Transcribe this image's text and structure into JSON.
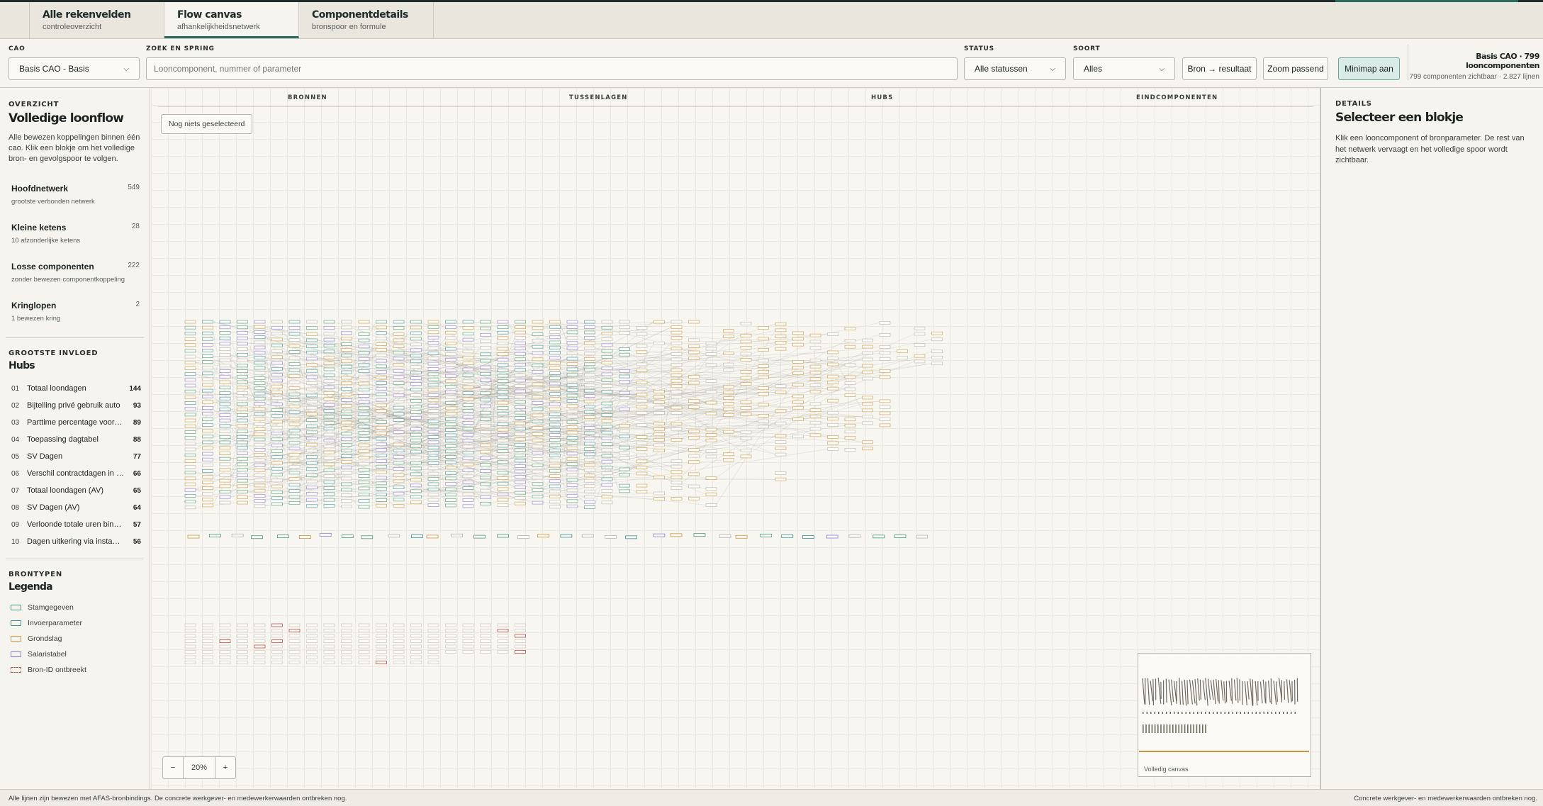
{
  "tabs": [
    {
      "title": "Alle rekenvelden",
      "sub": "controleoverzicht"
    },
    {
      "title": "Flow canvas",
      "sub": "afhankelijkheidsnetwerk"
    },
    {
      "title": "Componentdetails",
      "sub": "bronspoor en formule"
    }
  ],
  "filters": {
    "cao_label": "CAO",
    "cao_value": "Basis CAO - Basis",
    "search_label": "ZOEK EN SPRING",
    "search_placeholder": "Looncomponent, nummer of parameter",
    "status_label": "STATUS",
    "status_value": "Alle statussen",
    "soort_label": "SOORT",
    "soort_value": "Alles",
    "btn_bron": "Bron → resultaat",
    "btn_zoom": "Zoom passend",
    "btn_minimap": "Minimap aan"
  },
  "summary": {
    "title": "Basis CAO · 799 looncomponenten",
    "sub": "799 componenten zichtbaar · 2.827 lijnen"
  },
  "overview": {
    "eyebrow": "OVERZICHT",
    "title": "Volledige loonflow",
    "desc": "Alle bewezen koppelingen binnen één cao. Klik een blokje om het volledige bron- en gevolgspoor te volgen.",
    "networks": [
      {
        "name": "Hoofdnetwerk",
        "sub": "grootste verbonden netwerk",
        "count": "549"
      },
      {
        "name": "Kleine ketens",
        "sub": "10 afzonderlijke ketens",
        "count": "28"
      },
      {
        "name": "Losse componenten",
        "sub": "zonder bewezen componentkoppeling",
        "count": "222"
      },
      {
        "name": "Kringlopen",
        "sub": "1 bewezen kring",
        "count": "2"
      }
    ]
  },
  "hubs": {
    "eyebrow": "GROOTSTE INVLOED",
    "title": "Hubs",
    "items": [
      {
        "rank": "01",
        "name": "Totaal loondagen",
        "value": "144"
      },
      {
        "rank": "02",
        "name": "Bijtelling privé gebruik auto",
        "value": "93"
      },
      {
        "rank": "03",
        "name": "Parttime percentage voor to...",
        "value": "89"
      },
      {
        "rank": "04",
        "name": "Toepassing dagtabel",
        "value": "88"
      },
      {
        "rank": "05",
        "name": "SV Dagen",
        "value": "77"
      },
      {
        "rank": "06",
        "name": "Verschil contractdagen in p...",
        "value": "66"
      },
      {
        "rank": "07",
        "name": "Totaal loondagen (AV)",
        "value": "65"
      },
      {
        "rank": "08",
        "name": "SV Dagen (AV)",
        "value": "64"
      },
      {
        "rank": "09",
        "name": "Verloonde totale uren binne...",
        "value": "57"
      },
      {
        "rank": "10",
        "name": "Dagen uitkering via instantie",
        "value": "56"
      }
    ]
  },
  "legend": {
    "eyebrow": "BRONTYPEN",
    "title": "Legenda",
    "items": [
      {
        "name": "Stamgegeven",
        "color": "#4c9a72",
        "dashed": false
      },
      {
        "name": "Invoerparameter",
        "color": "#3f8f95",
        "dashed": false
      },
      {
        "name": "Grondslag",
        "color": "#c9953e",
        "dashed": false
      },
      {
        "name": "Salaristabel",
        "color": "#8a7bd0",
        "dashed": false
      },
      {
        "name": "Bron-ID ontbreekt",
        "color": "#c0504d",
        "dashed": true
      }
    ]
  },
  "canvas": {
    "columns": [
      "BRONNEN",
      "TUSSENLAGEN",
      "HUBS",
      "EINDCOMPONENTEN"
    ],
    "selection_chip": "Nog niets geselecteerd",
    "zoom_minus": "−",
    "zoom_value": "20%",
    "zoom_plus": "+",
    "minimap_label": "Volledig canvas"
  },
  "details": {
    "eyebrow": "DETAILS",
    "title": "Selecteer een blokje",
    "desc": "Klik een looncomponent of bronparameter. De rest van het netwerk vervaagt en het volledige spoor wordt zichtbaar."
  },
  "footer": {
    "left": "Alle lijnen zijn bewezen met AFAS-bronbindings. De concrete werkgever- en medewerkerwaarden ontbreken nog.",
    "right": "Concrete werkgever- en medewerkerwaarden ontbreken nog."
  },
  "colors": {
    "accent": "#2c6b5f",
    "stamgegeven": "#4c9a72",
    "invoer": "#3f8f95",
    "grondslag": "#c9953e",
    "salaristabel": "#8a7bd0",
    "ontbreekt": "#c0504d"
  }
}
